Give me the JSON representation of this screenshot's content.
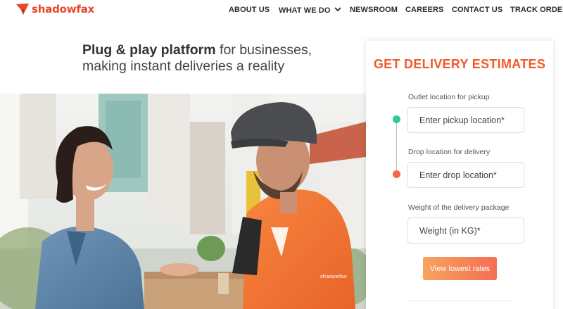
{
  "brand": {
    "name": "shadowfax",
    "accent_color": "#e8452c",
    "icon": "shadowfax-logo-icon"
  },
  "nav": {
    "items": [
      {
        "label": "ABOUT US"
      },
      {
        "label": "WHAT WE DO",
        "icon": "chevron-down-icon"
      },
      {
        "label": "NEWSROOM"
      },
      {
        "label": "CAREERS"
      },
      {
        "label": "CONTACT US"
      },
      {
        "label": "TRACK ORDER"
      }
    ]
  },
  "hero": {
    "tagline_bold": "Plug & play platform",
    "tagline_rest": " for businesses,",
    "tagline_line2": "making instant deliveries a reality",
    "uniform_brand": "shadowfax"
  },
  "estimate": {
    "title": "GET DELIVERY ESTIMATES",
    "title_color": "#f25a29",
    "pickup": {
      "label": "Outlet location for pickup",
      "placeholder": "Enter pickup location*",
      "value": ""
    },
    "drop": {
      "label": "Drop location for delivery",
      "placeholder": "Enter drop location*",
      "value": ""
    },
    "weight": {
      "label": "Weight of the delivery package",
      "placeholder": "Weight (in KG)*",
      "value": ""
    },
    "cta_label": "View lowest rates",
    "pickup_dot_color": "#2fc9a0",
    "drop_dot_color": "#f5674a"
  }
}
